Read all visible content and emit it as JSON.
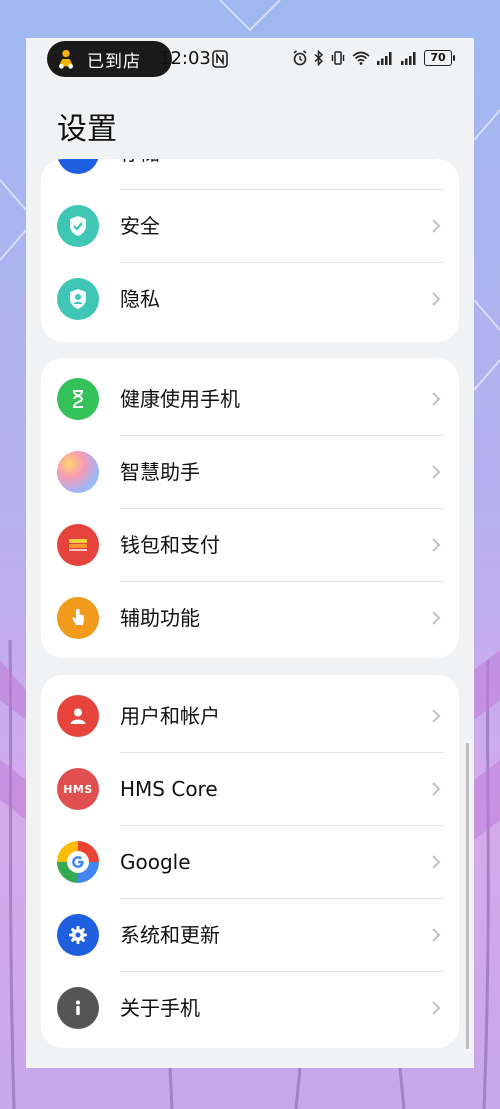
{
  "status_bar": {
    "pill_text": "已到店",
    "time": "12:03",
    "battery": "70"
  },
  "page_title": "设置",
  "sections": [
    {
      "items": [
        {
          "label": "存储",
          "icon": "storage-icon",
          "color": "#1e5fe0"
        },
        {
          "label": "安全",
          "icon": "shield-check-icon",
          "color": "#3fc6b4"
        },
        {
          "label": "隐私",
          "icon": "privacy-person-icon",
          "color": "#3fc6b4"
        }
      ]
    },
    {
      "items": [
        {
          "label": "健康使用手机",
          "icon": "hourglass-icon",
          "color": "#34c15a"
        },
        {
          "label": "智慧助手",
          "icon": "assistant-orb-icon",
          "color": "#c8a0ea"
        },
        {
          "label": "钱包和支付",
          "icon": "wallet-icon",
          "color": "#e6433c"
        },
        {
          "label": "辅助功能",
          "icon": "hand-icon",
          "color": "#f29a1b"
        }
      ]
    },
    {
      "items": [
        {
          "label": "用户和帐户",
          "icon": "user-icon",
          "color": "#e6433c"
        },
        {
          "label": "HMS Core",
          "icon": "hms-icon",
          "icon_text": "HMS",
          "color": "#e05050"
        },
        {
          "label": "Google",
          "icon": "google-icon",
          "color": "#4285f4"
        },
        {
          "label": "系统和更新",
          "icon": "gear-icon",
          "color": "#1e5fe0"
        },
        {
          "label": "关于手机",
          "icon": "info-icon",
          "color": "#555555"
        }
      ]
    }
  ]
}
